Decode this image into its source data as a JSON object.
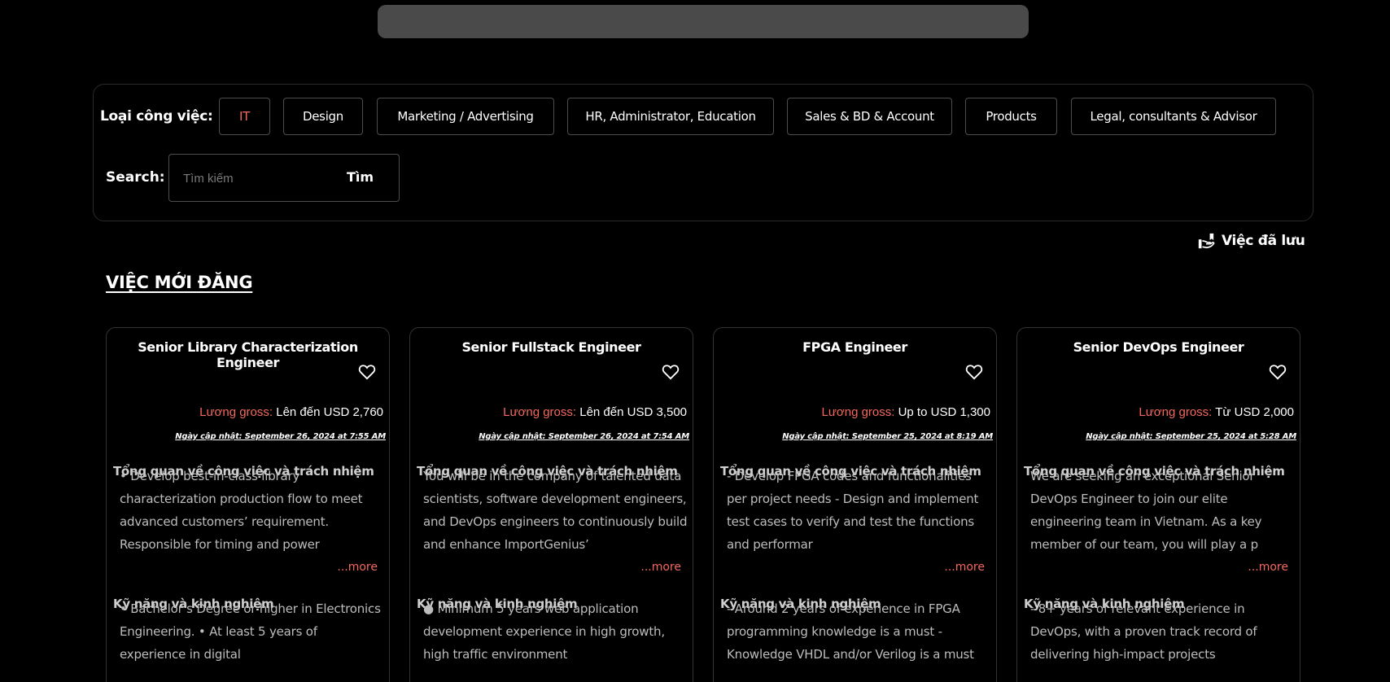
{
  "filters": {
    "type_label": "Loại công việc:",
    "categories": [
      {
        "label": "IT",
        "active": true
      },
      {
        "label": "Design",
        "active": false
      },
      {
        "label": "Marketing / Advertising",
        "active": false
      },
      {
        "label": "HR, Administrator, Education",
        "active": false
      },
      {
        "label": "Sales & BD & Account",
        "active": false
      },
      {
        "label": "Products",
        "active": false
      },
      {
        "label": "Legal, consultants & Advisor",
        "active": false
      }
    ],
    "search_label": "Search:",
    "search_placeholder": "Tìm kiếm",
    "search_button": "Tìm"
  },
  "saved_jobs_label": "Việc đã lưu",
  "section_title": "VIỆC MỚI ĐĂNG",
  "colors": {
    "accent": "#f2685f",
    "background": "#000000",
    "topbar": "#4a4a4a"
  },
  "jobs": [
    {
      "title": "Senior Library Characterization Engineer",
      "salary_label": "Lương gross:",
      "salary_value": "Lên đến USD 2,760",
      "updated": "Ngày cập nhật: September 26, 2024 at 7:55 AM",
      "overview_heading": "Tổng quan về công việc và trách nhiệm",
      "overview_text": "• Develop best-in-class library characterization production flow to meet advanced customers’ requirement. Responsible for timing and power",
      "more_label": "...more",
      "skills_heading": "Kỹ năng và kinh nghiệm",
      "skills_text": "• Bachelor’s Degree or higher in Electronics Engineering. • At least 5 years of experience in digital"
    },
    {
      "title": "Senior Fullstack Engineer",
      "salary_label": "Lương gross:",
      "salary_value": "Lên đến USD 3,500",
      "updated": "Ngày cập nhật: September 26, 2024 at 7:54 AM",
      "overview_heading": "Tổng quan về công việc và trách nhiệm",
      "overview_text": "You will be in the company of talented data scientists, software development engineers, and DevOps engineers to continuously build and enhance ImportGenius’",
      "more_label": "...more",
      "skills_heading": "Kỹ năng và kinh nghiệm",
      "skills_text": "● Minimum 5 years web application development experience in high growth, high traffic environment"
    },
    {
      "title": "FPGA Engineer",
      "salary_label": "Lương gross:",
      "salary_value": "Up to USD 1,300",
      "updated": "Ngày cập nhật: September 25, 2024 at 8:19 AM",
      "overview_heading": "Tổng quan về công việc và trách nhiệm",
      "overview_text": "- Develop FPGA codes and functionalities per project needs - Design and implement test cases to verify and test the functions and performar",
      "more_label": "...more",
      "skills_heading": "Kỹ năng và kinh nghiệm",
      "skills_text": "- Around 2 years of experience in FPGA programming knowledge is a must - Knowledge VHDL and/or Verilog is a must"
    },
    {
      "title": "Senior DevOps Engineer",
      "salary_label": "Lương gross:",
      "salary_value": "Từ USD 2,000",
      "updated": "Ngày cập nhật: September 25, 2024 at 5:28 AM",
      "overview_heading": "Tổng quan về công việc và trách nhiệm",
      "overview_text": "We are seeking an exceptional Senior DevOps Engineer to join our elite engineering team in Vietnam. As a key member of our team, you will play a p",
      "more_label": "...more",
      "skills_heading": "Kỹ năng và kinh nghiệm",
      "skills_text": "- 8+ years of relevant experience in DevOps, with a proven track record of delivering high-impact projects"
    }
  ]
}
